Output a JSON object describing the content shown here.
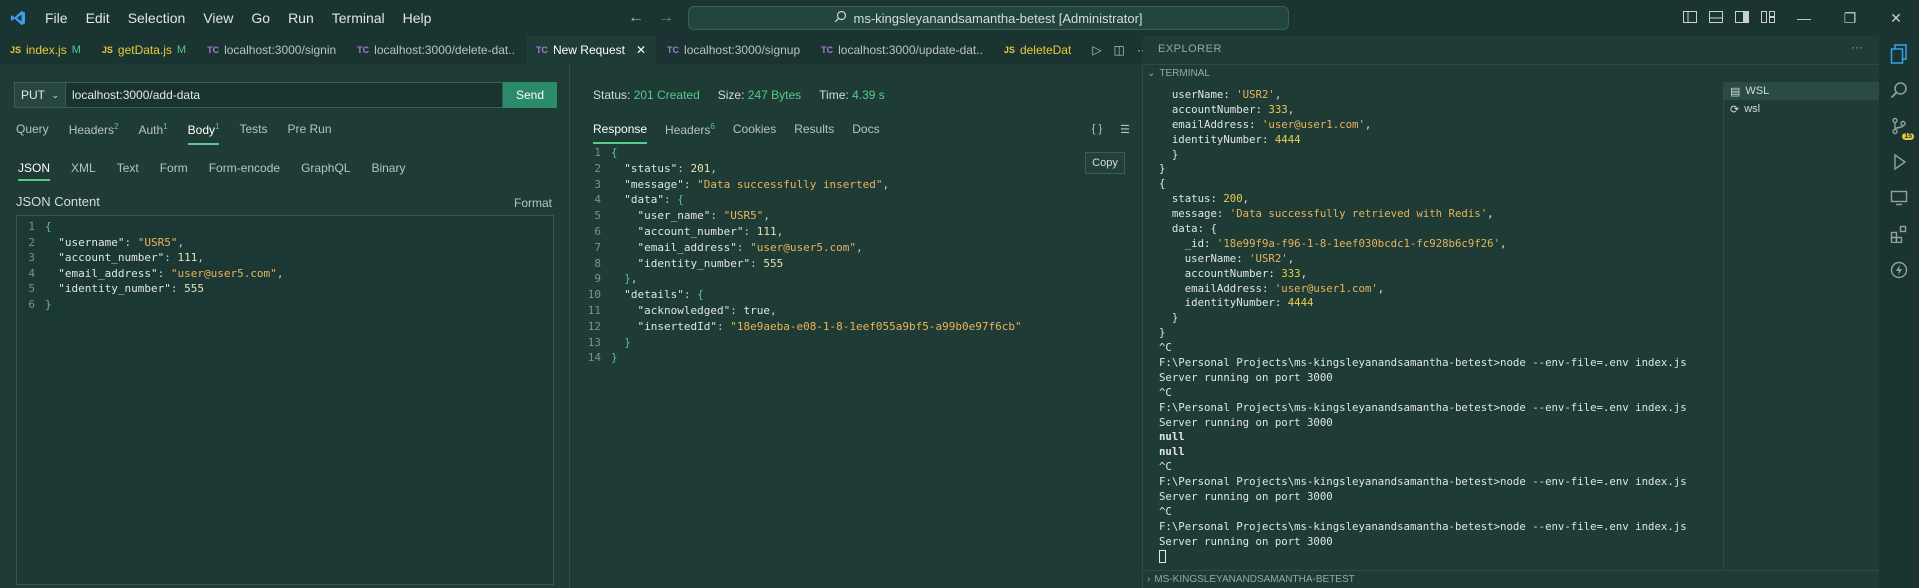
{
  "titlebar": {
    "menu": [
      "File",
      "Edit",
      "Selection",
      "View",
      "Go",
      "Run",
      "Terminal",
      "Help"
    ],
    "search": "ms-kingsleyanandsamantha-betest [Administrator]"
  },
  "tabs": [
    {
      "icon": "JS",
      "label": "index.js",
      "badge": "M"
    },
    {
      "icon": "JS",
      "label": "getData.js",
      "badge": "M"
    },
    {
      "icon": "TC",
      "label": "localhost:3000/signin",
      "badge": ""
    },
    {
      "icon": "TC",
      "label": "localhost:3000/delete-dat..",
      "badge": ""
    },
    {
      "icon": "TC",
      "label": "New Request",
      "badge": "✕"
    },
    {
      "icon": "TC",
      "label": "localhost:3000/signup",
      "badge": ""
    },
    {
      "icon": "TC",
      "label": "localhost:3000/update-dat..",
      "badge": ""
    },
    {
      "icon": "JS",
      "label": "deleteDat",
      "badge": ""
    }
  ],
  "request": {
    "method": "PUT",
    "url": "localhost:3000/add-data",
    "send": "Send",
    "tabs": {
      "query": "Query",
      "headers": "Headers",
      "headers_count": "2",
      "auth": "Auth",
      "auth_count": "1",
      "body": "Body",
      "body_count": "1",
      "tests": "Tests",
      "prerun": "Pre Run"
    },
    "body_types": [
      "JSON",
      "XML",
      "Text",
      "Form",
      "Form-encode",
      "GraphQL",
      "Binary"
    ],
    "json_label": "JSON Content",
    "format": "Format"
  },
  "response": {
    "status_label": "Status:",
    "status_value": "201 Created",
    "size_label": "Size:",
    "size_value": "247 Bytes",
    "time_label": "Time:",
    "time_value": "4.39 s",
    "tabs": {
      "response": "Response",
      "headers": "Headers",
      "headers_count": "6",
      "cookies": "Cookies",
      "results": "Results",
      "docs": "Docs"
    },
    "copy": "Copy"
  },
  "panel": {
    "explorer": "EXPLORER",
    "terminal": "TERMINAL",
    "bottom": "MS-KINGSLEYANANDSAMANTHA-BETEST",
    "terminals": [
      "WSL",
      "wsl"
    ]
  }
}
